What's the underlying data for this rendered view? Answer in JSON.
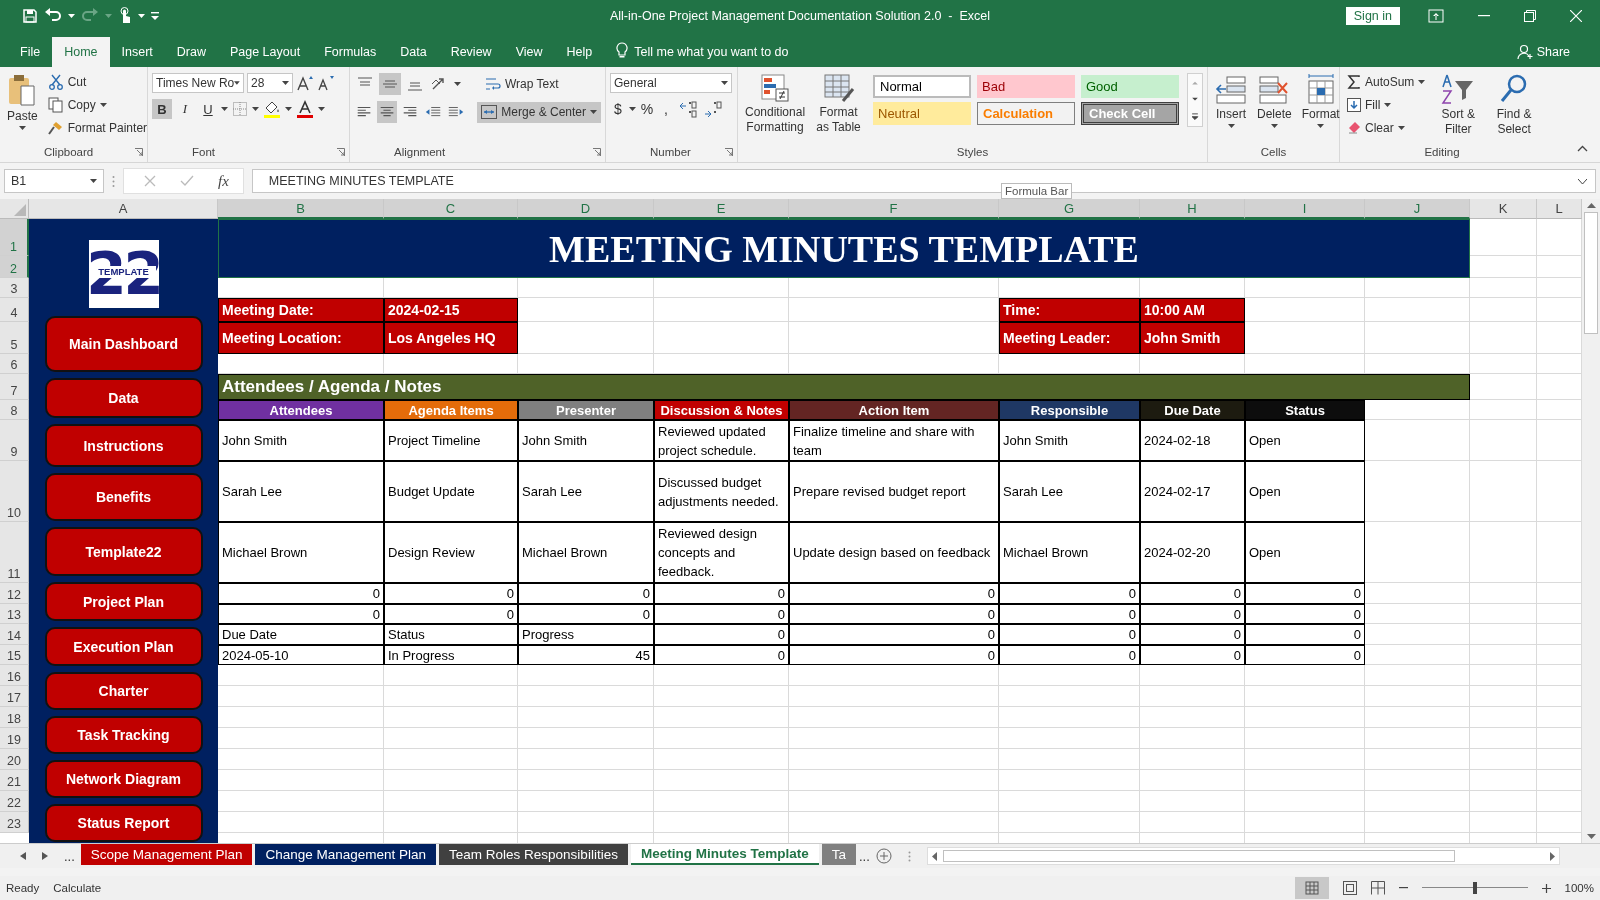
{
  "title_bar": {
    "title": "All-in-One Project Management Documentation Solution 2.0  -  Excel",
    "sign_in": "Sign in"
  },
  "menu_tabs": [
    {
      "label": "File",
      "selected": false
    },
    {
      "label": "Home",
      "selected": true
    },
    {
      "label": "Insert",
      "selected": false
    },
    {
      "label": "Draw",
      "selected": false
    },
    {
      "label": "Page Layout",
      "selected": false
    },
    {
      "label": "Formulas",
      "selected": false
    },
    {
      "label": "Data",
      "selected": false
    },
    {
      "label": "Review",
      "selected": false
    },
    {
      "label": "View",
      "selected": false
    },
    {
      "label": "Help",
      "selected": false
    }
  ],
  "tell_me": "Tell me what you want to do",
  "share": "Share",
  "ribbon": {
    "clipboard": {
      "label": "Clipboard",
      "paste": "Paste",
      "cut": "Cut",
      "copy": "Copy",
      "format_painter": "Format Painter"
    },
    "font": {
      "label": "Font",
      "name": "Times New Ro",
      "size": "28",
      "bold_key": "B",
      "italic_key": "I",
      "underline_key": "U",
      "bold": true,
      "italic": false,
      "underline": false
    },
    "alignment": {
      "label": "Alignment",
      "wrap_text": "Wrap Text",
      "merge_center": "Merge & Center",
      "merged": true,
      "vertical": [
        {
          "selected": false
        },
        {
          "selected": true
        },
        {
          "selected": false
        }
      ],
      "horizontal": [
        {
          "selected": false
        },
        {
          "selected": true
        },
        {
          "selected": false
        }
      ]
    },
    "number": {
      "label": "Number",
      "format": "General",
      "currency": "$",
      "percent": "%",
      "comma": ","
    },
    "styles": {
      "label": "Styles",
      "conditional": "Conditional Formatting",
      "format_table": "Format as Table",
      "cells": [
        {
          "label": "Normal",
          "kind": "normal"
        },
        {
          "label": "Bad",
          "kind": "bad"
        },
        {
          "label": "Good",
          "kind": "good"
        },
        {
          "label": "Neutral",
          "kind": "neutral"
        },
        {
          "label": "Calculation",
          "kind": "calculation"
        },
        {
          "label": "Check Cell",
          "kind": "check"
        }
      ]
    },
    "cells": {
      "label": "Cells",
      "insert": "Insert",
      "delete": "Delete",
      "format": "Format"
    },
    "editing": {
      "label": "Editing",
      "autosum": "AutoSum",
      "fill": "Fill",
      "clear": "Clear",
      "sort_filter": "Sort & Filter",
      "find_select": "Find & Select"
    }
  },
  "formula_bar": {
    "name_box": "B1",
    "fx": "fx",
    "content": "MEETING MINUTES TEMPLATE",
    "tooltip": "Formula Bar"
  },
  "column_headers": [
    {
      "label": "A",
      "selected": false
    },
    {
      "label": "B",
      "selected": true
    },
    {
      "label": "C",
      "selected": true
    },
    {
      "label": "D",
      "selected": true
    },
    {
      "label": "E",
      "selected": true
    },
    {
      "label": "F",
      "selected": true
    },
    {
      "label": "G",
      "selected": true
    },
    {
      "label": "H",
      "selected": true
    },
    {
      "label": "I",
      "selected": true
    },
    {
      "label": "J",
      "selected": true
    },
    {
      "label": "K",
      "selected": false
    },
    {
      "label": "L",
      "selected": false
    }
  ],
  "row_headers": [
    {
      "label": "1",
      "selected": true
    },
    {
      "label": "2",
      "selected": true
    },
    {
      "label": "3",
      "selected": false
    },
    {
      "label": "4",
      "selected": false
    },
    {
      "label": "5",
      "selected": false
    },
    {
      "label": "6",
      "selected": false
    },
    {
      "label": "7",
      "selected": false
    },
    {
      "label": "8",
      "selected": false
    },
    {
      "label": "9",
      "selected": false
    },
    {
      "label": "10",
      "selected": false
    },
    {
      "label": "11",
      "selected": false
    },
    {
      "label": "12",
      "selected": false
    },
    {
      "label": "13",
      "selected": false
    },
    {
      "label": "14",
      "selected": false
    },
    {
      "label": "15",
      "selected": false
    },
    {
      "label": "16",
      "selected": false
    },
    {
      "label": "17",
      "selected": false
    },
    {
      "label": "18",
      "selected": false
    },
    {
      "label": "19",
      "selected": false
    },
    {
      "label": "20",
      "selected": false
    },
    {
      "label": "21",
      "selected": false
    },
    {
      "label": "22",
      "selected": false
    },
    {
      "label": "23",
      "selected": false
    }
  ],
  "logo": {
    "number": "22",
    "word": "TEMPLATE"
  },
  "nav_buttons": [
    "Main Dashboard",
    "Data",
    "Instructions",
    "Benefits",
    "Template22",
    "Project Plan",
    "Execution Plan",
    "Charter",
    "Task Tracking",
    "Network Diagram",
    "Status Report"
  ],
  "sheet_title": "MEETING MINUTES TEMPLATE",
  "meeting_info": [
    {
      "label": "Meeting Date:",
      "value": "2024-02-15"
    },
    {
      "label": "Meeting Location:",
      "value": "Los Angeles HQ"
    },
    {
      "label": "Time:",
      "value": "10:00 AM"
    },
    {
      "label": "Meeting Leader:",
      "value": "John Smith"
    }
  ],
  "section_title": "Attendees / Agenda / Notes",
  "table": {
    "columns": [
      {
        "label": "Attendees",
        "color": "#7030a0"
      },
      {
        "label": "Agenda Items",
        "color": "#e46c0a"
      },
      {
        "label": "Presenter",
        "color": "#7f7f7f"
      },
      {
        "label": "Discussion & Notes",
        "color": "#c00000"
      },
      {
        "label": "Action Item",
        "color": "#632523"
      },
      {
        "label": "Responsible",
        "color": "#1f3864"
      },
      {
        "label": "Due Date",
        "color": "#1d1b10"
      },
      {
        "label": "Status",
        "color": "#0d0d0d"
      }
    ],
    "rows": [
      [
        "John Smith",
        "Project Timeline",
        "John Smith",
        "Reviewed updated project schedule.",
        "Finalize timeline and share with team",
        "John Smith",
        "2024-02-18",
        "Open"
      ],
      [
        "Sarah Lee",
        "Budget Update",
        "Sarah Lee",
        "Discussed budget adjustments needed.",
        "Prepare revised budget report",
        "Sarah Lee",
        "2024-02-17",
        "Open"
      ],
      [
        "Michael Brown",
        "Design Review",
        "Michael Brown",
        "Reviewed design concepts and feedback.",
        "Update design based on feedback",
        "Michael Brown",
        "2024-02-20",
        "Open"
      ]
    ],
    "extra_rows": [
      [
        {
          "text": "0",
          "kind": "number"
        },
        {
          "text": "0",
          "kind": "number"
        },
        {
          "text": "0",
          "kind": "number"
        },
        {
          "text": "0",
          "kind": "number"
        },
        {
          "text": "0",
          "kind": "number"
        },
        {
          "text": "0",
          "kind": "number"
        },
        {
          "text": "0",
          "kind": "number"
        },
        {
          "text": "0",
          "kind": "number"
        }
      ],
      [
        {
          "text": "0",
          "kind": "number"
        },
        {
          "text": "0",
          "kind": "number"
        },
        {
          "text": "0",
          "kind": "number"
        },
        {
          "text": "0",
          "kind": "number"
        },
        {
          "text": "0",
          "kind": "number"
        },
        {
          "text": "0",
          "kind": "number"
        },
        {
          "text": "0",
          "kind": "number"
        },
        {
          "text": "0",
          "kind": "number"
        }
      ],
      [
        {
          "text": "Due Date",
          "kind": "text"
        },
        {
          "text": "Status",
          "kind": "text"
        },
        {
          "text": "Progress",
          "kind": "text"
        },
        {
          "text": "0",
          "kind": "number"
        },
        {
          "text": "0",
          "kind": "number"
        },
        {
          "text": "0",
          "kind": "number"
        },
        {
          "text": "0",
          "kind": "number"
        },
        {
          "text": "0",
          "kind": "number"
        }
      ],
      [
        {
          "text": "2024-05-10",
          "kind": "text"
        },
        {
          "text": "In Progress",
          "kind": "text"
        },
        {
          "text": "45",
          "kind": "number"
        },
        {
          "text": "0",
          "kind": "number"
        },
        {
          "text": "0",
          "kind": "number"
        },
        {
          "text": "0",
          "kind": "number"
        },
        {
          "text": "0",
          "kind": "number"
        },
        {
          "text": "0",
          "kind": "number"
        }
      ]
    ]
  },
  "sheet_tabs": {
    "more_left": "...",
    "more_right": "...",
    "tabs": [
      {
        "label": "Scope Management Plan",
        "color": "#c00000",
        "selected": false
      },
      {
        "label": "Change Management Plan",
        "color": "#002060",
        "selected": false
      },
      {
        "label": "Team Roles Responsibilities",
        "color": "#404040",
        "selected": false
      },
      {
        "label": "Meeting Minutes Template",
        "color": "#ffffff",
        "selected": true
      },
      {
        "label": "Ta",
        "color": "#808080",
        "selected": false
      }
    ]
  },
  "status_bar": {
    "mode": "Ready",
    "calc": "Calculate",
    "zoom": "100%",
    "zoom_slider": {
      "level": 0.5
    }
  }
}
